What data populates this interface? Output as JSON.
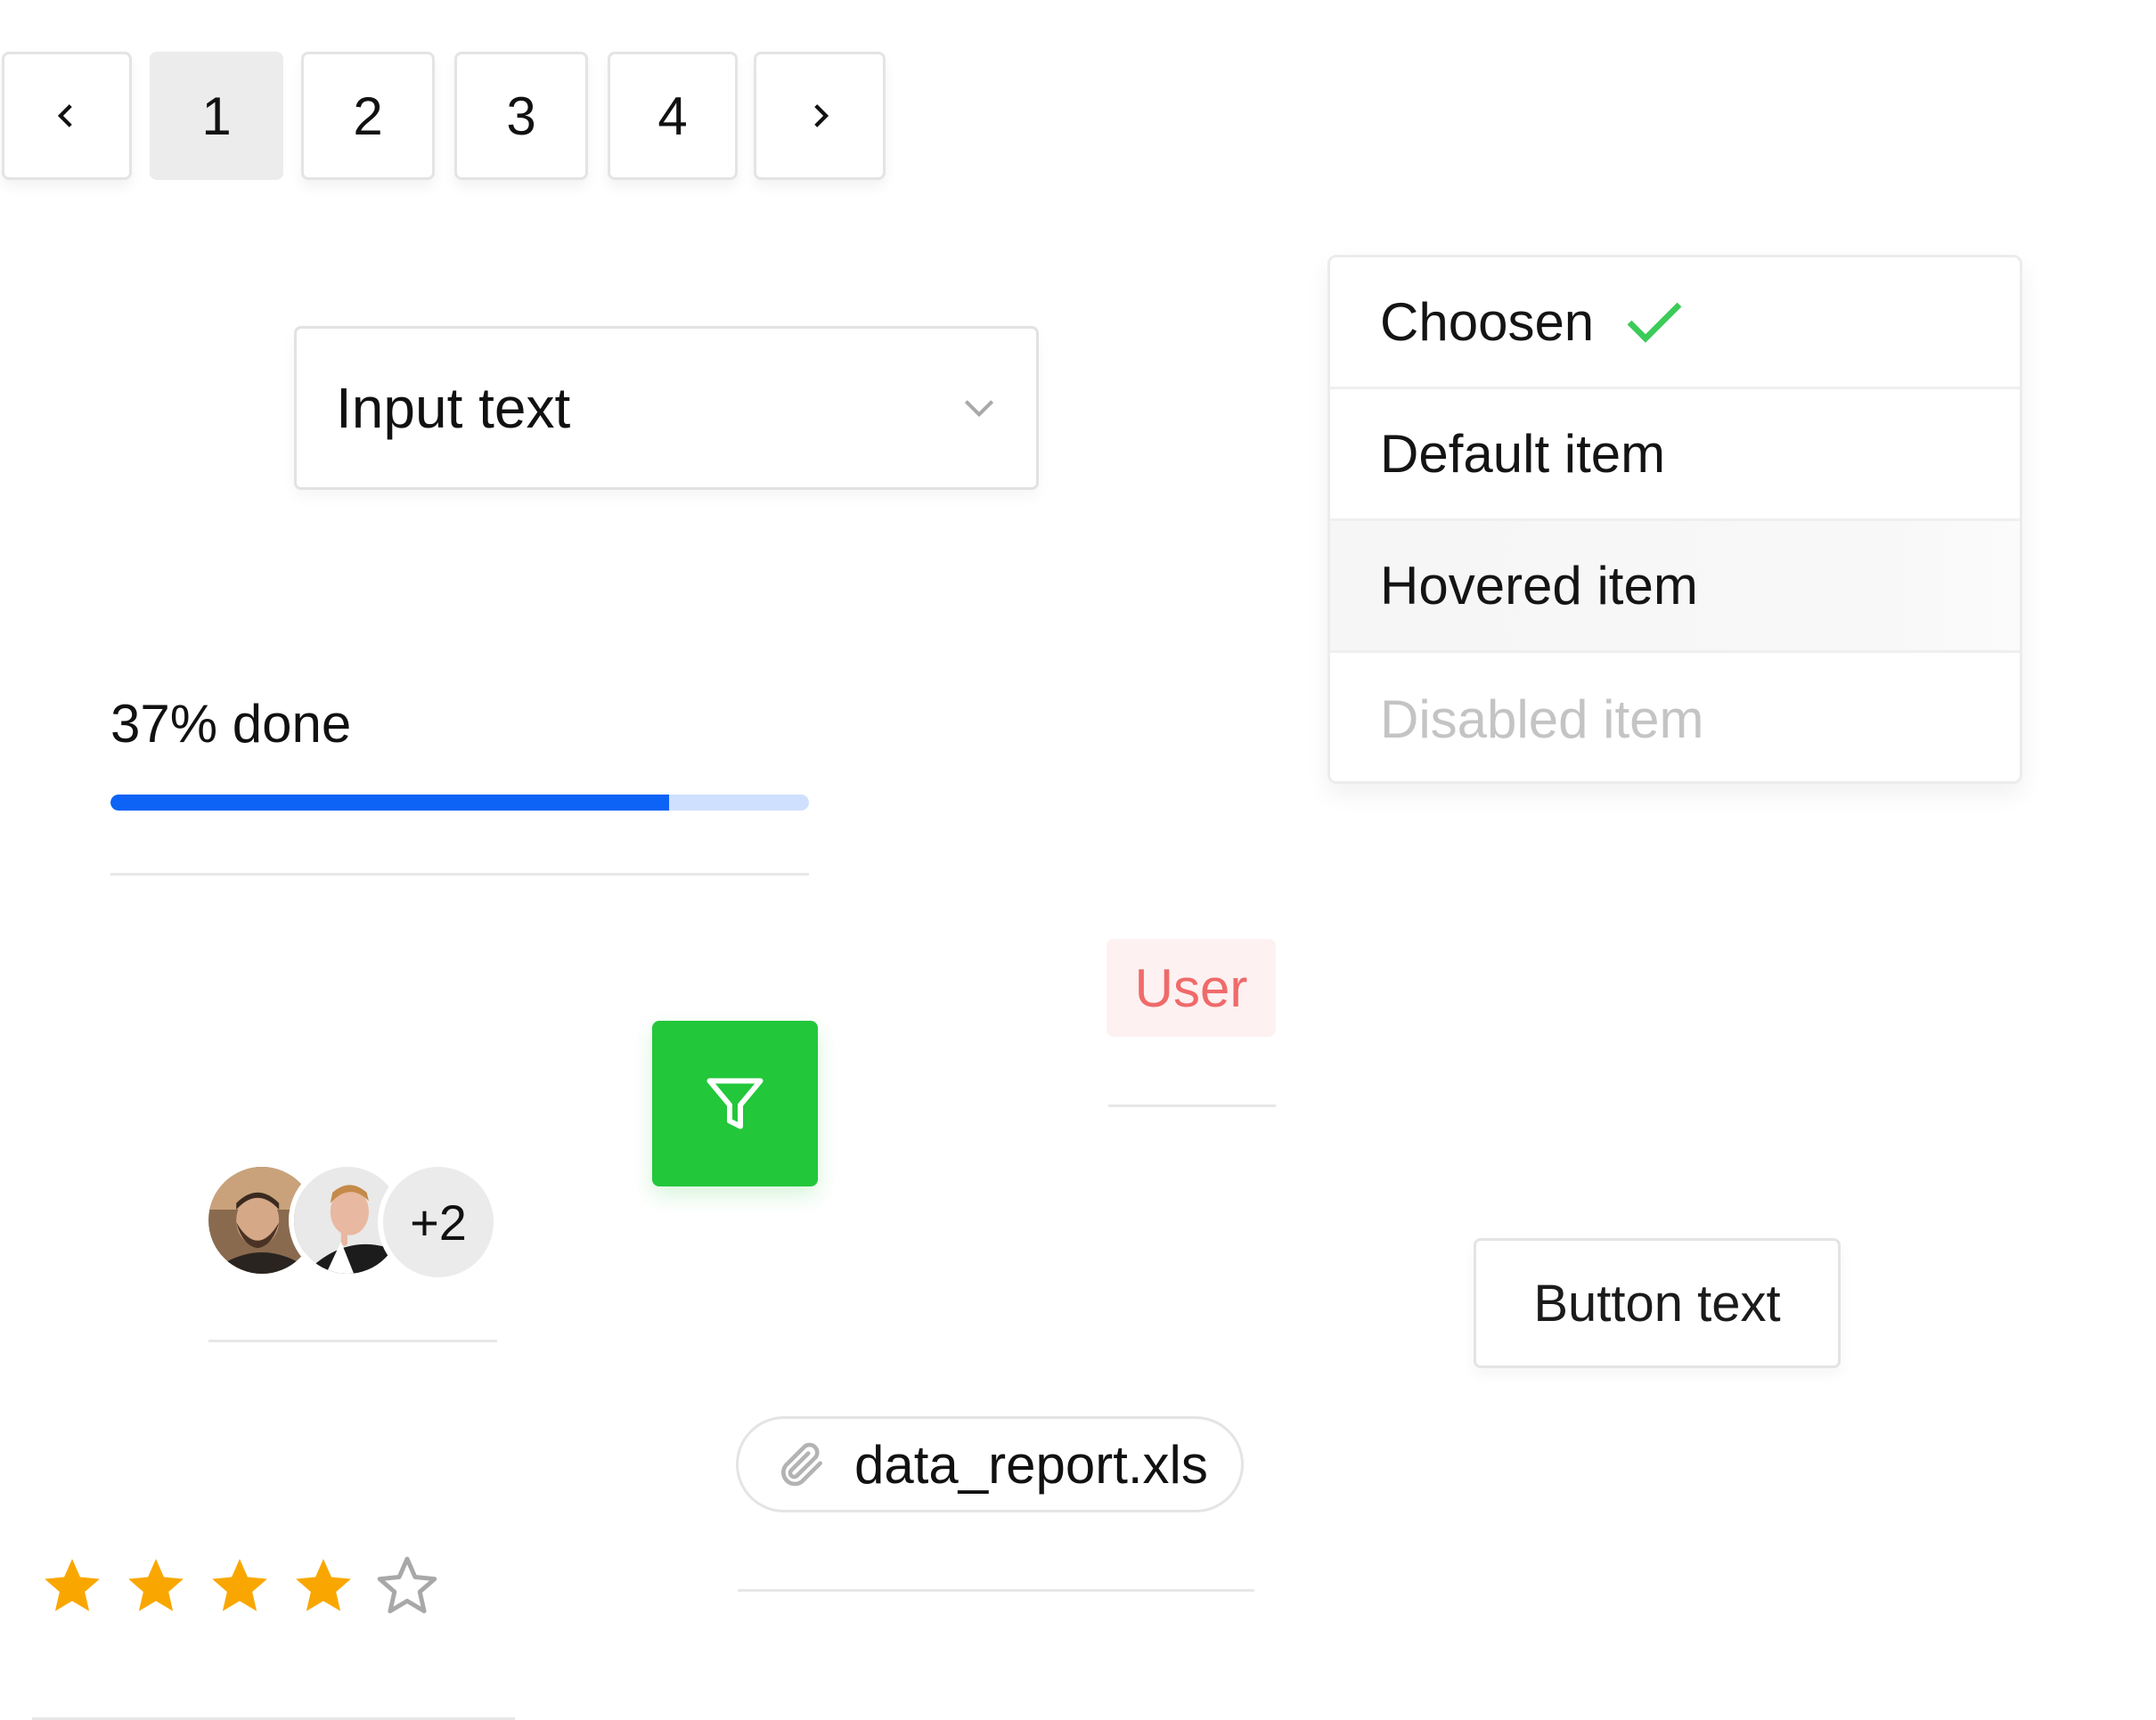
{
  "pagination": {
    "prev_icon": "chevron-left-icon",
    "pages": [
      "1",
      "2",
      "3",
      "4"
    ],
    "active_page": "1",
    "next_icon": "chevron-right-icon"
  },
  "select": {
    "value": "Input text",
    "icon": "chevron-down-icon"
  },
  "dropdown": {
    "items": [
      {
        "label": "Choosen",
        "state": "selected"
      },
      {
        "label": "Default item",
        "state": "default"
      },
      {
        "label": "Hovered item",
        "state": "hovered"
      },
      {
        "label": "Disabled item",
        "state": "disabled"
      }
    ],
    "check_color": "#3ccb58"
  },
  "progress": {
    "label": "37% done",
    "value": 0.8,
    "fill_color": "#0d63f5",
    "track_color": "#cfe0ff"
  },
  "tag": {
    "label": "User",
    "text_color": "#f06a6a",
    "bg_color": "#fdf1f1"
  },
  "filter_button": {
    "icon": "filter-icon",
    "bg_color": "#22c73a"
  },
  "avatars": {
    "people": [
      "avatar-1",
      "avatar-2"
    ],
    "more_label": "+2"
  },
  "button": {
    "label": "Button text"
  },
  "attachment": {
    "icon": "paperclip-icon",
    "filename": "data_report.xls"
  },
  "rating": {
    "value": 4,
    "max": 5,
    "color": "#f9a700",
    "empty_color": "#a8a8a8"
  }
}
